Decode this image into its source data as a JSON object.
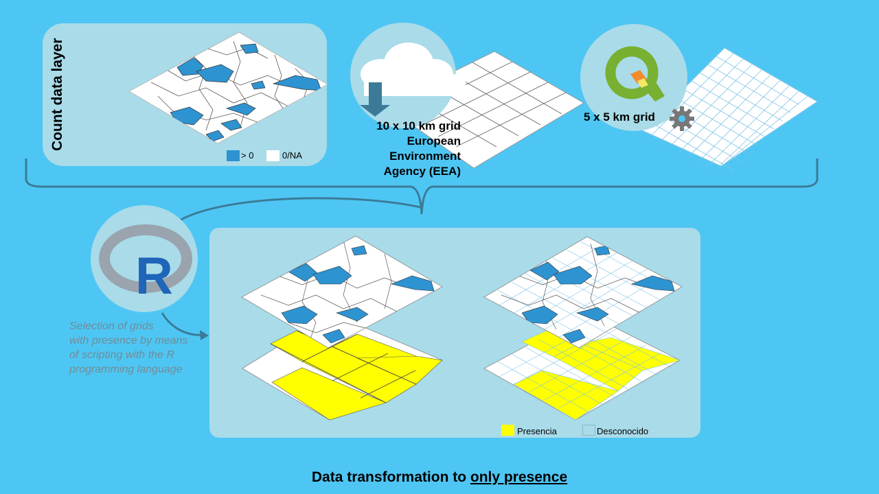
{
  "count_panel": {
    "title": "Count data layer",
    "legend": [
      {
        "label": "> 0",
        "color": "#2e93d1"
      },
      {
        "label": "0/NA",
        "color": "#ffffff"
      }
    ]
  },
  "eea_grid": {
    "label_line1": "10 x 10 km grid",
    "label_line2": "European",
    "label_line3": "Environment",
    "label_line4": "Agency (EEA)"
  },
  "qgis_grid": {
    "label": "5 x 5 km grid"
  },
  "r_step": {
    "caption_line1": "Selection of grids",
    "caption_line2": "with presence by means",
    "caption_line3": "of scripting with the R",
    "caption_line4": "programming language"
  },
  "result_legend": [
    {
      "label": "Presencia",
      "color": "#ffff00"
    },
    {
      "label": "Desconocido",
      "color": "#a9dbe9"
    }
  ],
  "footer": {
    "title_prefix": "Data transformation to ",
    "title_emphasis": "only presence"
  },
  "colors": {
    "background": "#4ec6f3",
    "panel": "#a9dbe9",
    "presence_blue": "#2e93d1",
    "presence_yellow": "#ffff00",
    "arrow": "#3b7b98"
  }
}
